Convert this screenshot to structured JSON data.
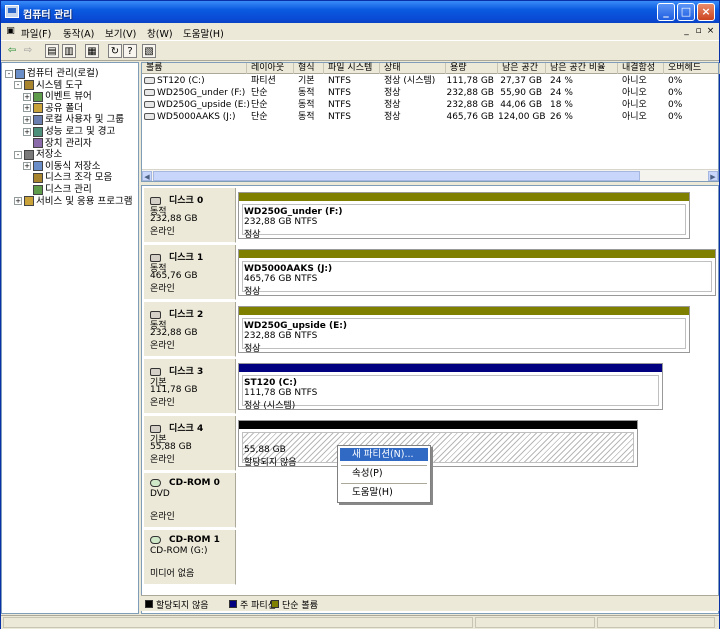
{
  "window": {
    "title": "컴퓨터 관리"
  },
  "title_buttons": {
    "minimize": "_",
    "maximize": "□",
    "close": "×"
  },
  "menu": [
    "파일(F)",
    "동작(A)",
    "보기(V)",
    "창(W)",
    "도움말(H)"
  ],
  "mdi_buttons": [
    "_",
    "▫",
    "×"
  ],
  "tree": [
    {
      "label": "컴퓨터 관리(로컬)",
      "indent": 0,
      "exp": "-",
      "icon": "computer-icon"
    },
    {
      "label": "시스템 도구",
      "indent": 1,
      "exp": "-",
      "icon": "tools-icon"
    },
    {
      "label": "이벤트 뷰어",
      "indent": 2,
      "exp": "+",
      "icon": "event-viewer-icon"
    },
    {
      "label": "공유 폴더",
      "indent": 2,
      "exp": "+",
      "icon": "shared-folder-icon"
    },
    {
      "label": "로컬 사용자 및 그룹",
      "indent": 2,
      "exp": "+",
      "icon": "users-icon"
    },
    {
      "label": "성능 로그 및 경고",
      "indent": 2,
      "exp": "+",
      "icon": "performance-icon"
    },
    {
      "label": "장치 관리자",
      "indent": 2,
      "exp": "",
      "icon": "device-manager-icon"
    },
    {
      "label": "저장소",
      "indent": 1,
      "exp": "-",
      "icon": "storage-icon"
    },
    {
      "label": "이동식 저장소",
      "indent": 2,
      "exp": "+",
      "icon": "removable-storage-icon"
    },
    {
      "label": "디스크 조각 모음",
      "indent": 2,
      "exp": "",
      "icon": "defrag-icon"
    },
    {
      "label": "디스크 관리",
      "indent": 2,
      "exp": "",
      "icon": "disk-management-icon"
    },
    {
      "label": "서비스 및 응용 프로그램",
      "indent": 1,
      "exp": "+",
      "icon": "services-icon"
    }
  ],
  "volume_columns": [
    "볼륨",
    "레이아웃",
    "형식",
    "파일 시스템",
    "상태",
    "용량",
    "남은 공간",
    "남은 공간 비율",
    "내결함성",
    "오버헤드"
  ],
  "volumes": [
    [
      "ST120 (C:)",
      "파티션",
      "기본",
      "NTFS",
      "정상 (시스템)",
      "111,78 GB",
      "27,37 GB",
      "24 %",
      "아니오",
      "0%"
    ],
    [
      "WD250G_under (F:)",
      "단순",
      "동적",
      "NTFS",
      "정상",
      "232,88 GB",
      "55,90 GB",
      "24 %",
      "아니오",
      "0%"
    ],
    [
      "WD250G_upside (E:)",
      "단순",
      "동적",
      "NTFS",
      "정상",
      "232,88 GB",
      "44,06 GB",
      "18 %",
      "아니오",
      "0%"
    ],
    [
      "WD5000AAKS (J:)",
      "단순",
      "동적",
      "NTFS",
      "정상",
      "465,76 GB",
      "124,00 GB",
      "26 %",
      "아니오",
      "0%"
    ]
  ],
  "disks": [
    {
      "name": "디스크 0",
      "type": "동적",
      "size": "232,88 GB",
      "state": "온라인",
      "partition": {
        "title": "WD250G_under  (F:)",
        "line1": "232,88 GB NTFS",
        "line2": "정상",
        "color": "#808000"
      }
    },
    {
      "name": "디스크 1",
      "type": "동적",
      "size": "465,76 GB",
      "state": "온라인",
      "partition": {
        "title": "WD5000AAKS  (J:)",
        "line1": "465,76 GB NTFS",
        "line2": "정상",
        "color": "#808000"
      }
    },
    {
      "name": "디스크 2",
      "type": "동적",
      "size": "232,88 GB",
      "state": "온라인",
      "partition": {
        "title": "WD250G_upside  (E:)",
        "line1": "232,88 GB NTFS",
        "line2": "정상",
        "color": "#808000"
      }
    },
    {
      "name": "디스크 3",
      "type": "기본",
      "size": "111,78 GB",
      "state": "온라인",
      "partition": {
        "title": "ST120  (C:)",
        "line1": "111,78 GB NTFS",
        "line2": "정상 (시스템)",
        "color": "#000080"
      }
    },
    {
      "name": "디스크 4",
      "type": "기본",
      "size": "55,88 GB",
      "state": "온라인",
      "partition": {
        "title": "",
        "line1": "55,88 GB",
        "line2": "할당되지 않음",
        "color": "#000000"
      }
    }
  ],
  "cdroms": [
    {
      "name": "CD-ROM 0",
      "line1": "DVD",
      "line2": "",
      "state": "온라인"
    },
    {
      "name": "CD-ROM 1",
      "line1": "CD-ROM (G:)",
      "line2": "",
      "state": "미디어 없음"
    }
  ],
  "context_menu": [
    "새 파티션(N)...",
    "속성(P)",
    "도움말(H)"
  ],
  "legend": [
    {
      "label": "할당되지 않음",
      "color": "#000000"
    },
    {
      "label": "주 파티션",
      "color": "#000080"
    },
    {
      "label": "단순 볼륨",
      "color": "#808000"
    }
  ],
  "colors": {
    "titlebar": "#0a4bd6",
    "highlight": "#316ac5",
    "simple_volume": "#808000",
    "primary_partition": "#000080"
  }
}
